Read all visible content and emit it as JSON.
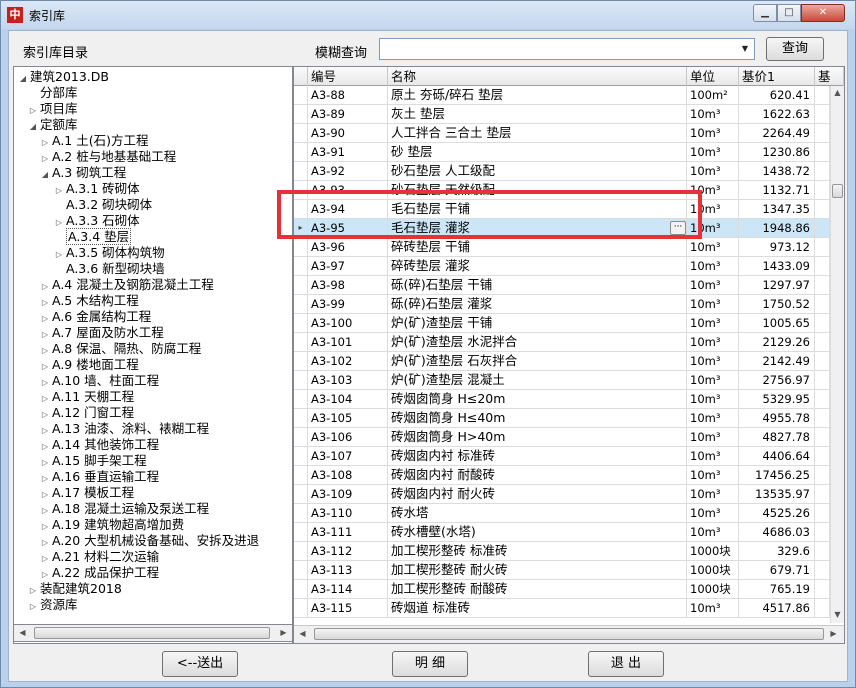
{
  "window": {
    "title": "索引库",
    "icon_glyph": "中"
  },
  "toolbar": {
    "dir_label": "索引库目录",
    "fuzzy_label": "模糊查询",
    "search_value": "",
    "search_placeholder": "",
    "query_label": "查询"
  },
  "tree": [
    {
      "label": "建筑2013.DB",
      "level": 0,
      "expander": "open"
    },
    {
      "label": "分部库",
      "level": 1,
      "expander": "none"
    },
    {
      "label": "项目库",
      "level": 1,
      "expander": "closed"
    },
    {
      "label": "定额库",
      "level": 1,
      "expander": "open"
    },
    {
      "label": "A.1 土(石)方工程",
      "level": 2,
      "expander": "closed"
    },
    {
      "label": "A.2 桩与地基基础工程",
      "level": 2,
      "expander": "closed"
    },
    {
      "label": "A.3 砌筑工程",
      "level": 2,
      "expander": "open"
    },
    {
      "label": "A.3.1 砖砌体",
      "level": 3,
      "expander": "closed"
    },
    {
      "label": "A.3.2 砌块砌体",
      "level": 3,
      "expander": "none"
    },
    {
      "label": "A.3.3 石砌体",
      "level": 3,
      "expander": "closed"
    },
    {
      "label": "A.3.4 垫层",
      "level": 3,
      "expander": "none",
      "selected": true
    },
    {
      "label": "A.3.5 砌体构筑物",
      "level": 3,
      "expander": "closed"
    },
    {
      "label": "A.3.6 新型砌块墙",
      "level": 3,
      "expander": "none"
    },
    {
      "label": "A.4 混凝土及钢筋混凝土工程",
      "level": 2,
      "expander": "closed"
    },
    {
      "label": "A.5 木结构工程",
      "level": 2,
      "expander": "closed"
    },
    {
      "label": "A.6 金属结构工程",
      "level": 2,
      "expander": "closed"
    },
    {
      "label": "A.7 屋面及防水工程",
      "level": 2,
      "expander": "closed"
    },
    {
      "label": "A.8 保温、隔热、防腐工程",
      "level": 2,
      "expander": "closed"
    },
    {
      "label": "A.9 楼地面工程",
      "level": 2,
      "expander": "closed"
    },
    {
      "label": "A.10 墙、柱面工程",
      "level": 2,
      "expander": "closed"
    },
    {
      "label": "A.11 天棚工程",
      "level": 2,
      "expander": "closed"
    },
    {
      "label": "A.12 门窗工程",
      "level": 2,
      "expander": "closed"
    },
    {
      "label": "A.13 油漆、涂料、裱糊工程",
      "level": 2,
      "expander": "closed"
    },
    {
      "label": "A.14 其他装饰工程",
      "level": 2,
      "expander": "closed"
    },
    {
      "label": "A.15 脚手架工程",
      "level": 2,
      "expander": "closed"
    },
    {
      "label": "A.16 垂直运输工程",
      "level": 2,
      "expander": "closed"
    },
    {
      "label": "A.17 模板工程",
      "level": 2,
      "expander": "closed"
    },
    {
      "label": "A.18 混凝土运输及泵送工程",
      "level": 2,
      "expander": "closed"
    },
    {
      "label": "A.19 建筑物超高增加费",
      "level": 2,
      "expander": "closed"
    },
    {
      "label": "A.20 大型机械设备基础、安拆及进退",
      "level": 2,
      "expander": "closed"
    },
    {
      "label": "A.21 材料二次运输",
      "level": 2,
      "expander": "closed"
    },
    {
      "label": "A.22 成品保护工程",
      "level": 2,
      "expander": "closed"
    },
    {
      "label": "装配建筑2018",
      "level": 1,
      "expander": "closed"
    },
    {
      "label": "资源库",
      "level": 1,
      "expander": "closed"
    }
  ],
  "grid": {
    "headers": [
      "编号",
      "名称",
      "单位",
      "基价1",
      "基"
    ],
    "current_marker": "▸",
    "rows": [
      {
        "code": "A3-88",
        "name": "原土 夯砾/碎石 垫层",
        "unit": "100m²",
        "price": "620.41"
      },
      {
        "code": "A3-89",
        "name": "灰土 垫层",
        "unit": "10m³",
        "price": "1622.63"
      },
      {
        "code": "A3-90",
        "name": "人工拌合 三合土 垫层",
        "unit": "10m³",
        "price": "2264.49"
      },
      {
        "code": "A3-91",
        "name": "砂 垫层",
        "unit": "10m³",
        "price": "1230.86"
      },
      {
        "code": "A3-92",
        "name": "砂石垫层 人工级配",
        "unit": "10m³",
        "price": "1438.72"
      },
      {
        "code": "A3-93",
        "name": "砂石垫层 天然级配",
        "unit": "10m³",
        "price": "1132.71"
      },
      {
        "code": "A3-94",
        "name": "毛石垫层 干铺",
        "unit": "10m³",
        "price": "1347.35"
      },
      {
        "code": "A3-95",
        "name": "毛石垫层 灌浆",
        "unit": "10m³",
        "price": "1948.86",
        "current": true
      },
      {
        "code": "A3-96",
        "name": "碎砖垫层 干铺",
        "unit": "10m³",
        "price": "973.12"
      },
      {
        "code": "A3-97",
        "name": "碎砖垫层 灌浆",
        "unit": "10m³",
        "price": "1433.09"
      },
      {
        "code": "A3-98",
        "name": "砾(碎)石垫层 干铺",
        "unit": "10m³",
        "price": "1297.97"
      },
      {
        "code": "A3-99",
        "name": "砾(碎)石垫层 灌浆",
        "unit": "10m³",
        "price": "1750.52"
      },
      {
        "code": "A3-100",
        "name": "炉(矿)渣垫层 干铺",
        "unit": "10m³",
        "price": "1005.65"
      },
      {
        "code": "A3-101",
        "name": "炉(矿)渣垫层 水泥拌合",
        "unit": "10m³",
        "price": "2129.26"
      },
      {
        "code": "A3-102",
        "name": "炉(矿)渣垫层 石灰拌合",
        "unit": "10m³",
        "price": "2142.49"
      },
      {
        "code": "A3-103",
        "name": "炉(矿)渣垫层 混凝土",
        "unit": "10m³",
        "price": "2756.97"
      },
      {
        "code": "A3-104",
        "name": "砖烟囱筒身 H≤20m",
        "unit": "10m³",
        "price": "5329.95"
      },
      {
        "code": "A3-105",
        "name": "砖烟囱筒身 H≤40m",
        "unit": "10m³",
        "price": "4955.78"
      },
      {
        "code": "A3-106",
        "name": "砖烟囱筒身 H>40m",
        "unit": "10m³",
        "price": "4827.78"
      },
      {
        "code": "A3-107",
        "name": "砖烟囱内衬 标准砖",
        "unit": "10m³",
        "price": "4406.64"
      },
      {
        "code": "A3-108",
        "name": "砖烟囱内衬 耐酸砖",
        "unit": "10m³",
        "price": "17456.25"
      },
      {
        "code": "A3-109",
        "name": "砖烟囱内衬 耐火砖",
        "unit": "10m³",
        "price": "13535.97"
      },
      {
        "code": "A3-110",
        "name": "砖水塔",
        "unit": "10m³",
        "price": "4525.26"
      },
      {
        "code": "A3-111",
        "name": "砖水槽壁(水塔)",
        "unit": "10m³",
        "price": "4686.03"
      },
      {
        "code": "A3-112",
        "name": "加工楔形整砖 标准砖",
        "unit": "1000块",
        "price": "329.6"
      },
      {
        "code": "A3-113",
        "name": "加工楔形整砖 耐火砖",
        "unit": "1000块",
        "price": "679.71"
      },
      {
        "code": "A3-114",
        "name": "加工楔形整砖 耐酸砖",
        "unit": "1000块",
        "price": "765.19"
      },
      {
        "code": "A3-115",
        "name": "砖烟道 标准砖",
        "unit": "10m³",
        "price": "4517.86"
      }
    ]
  },
  "footer": {
    "send_label": "<--送出",
    "detail_label": "明 细",
    "exit_label": "退 出"
  },
  "colors": {
    "highlight": "#e8303a",
    "current_row": "#cde6f7",
    "window_frame": "#b9d1ea"
  }
}
